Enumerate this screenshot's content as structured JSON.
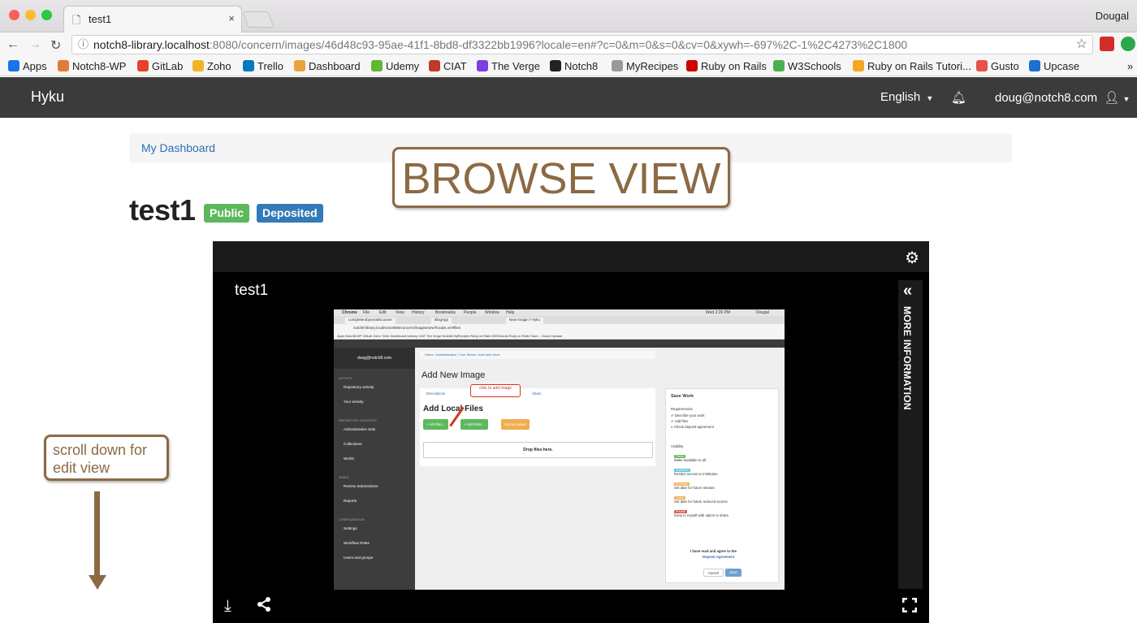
{
  "browser": {
    "tab_title": "test1",
    "tab_close": "×",
    "profile_name": "Dougal",
    "url_host": "notch8-library.localhost",
    "url_rest": ":8080/concern/images/46d48c93-95ae-41f1-8bd8-df3322bb1996?locale=en#?c=0&m=0&s=0&cv=0&xywh=-697%2C-1%2C4273%2C1800",
    "bookmarks": [
      {
        "label": "Apps",
        "color": "#1a73e8"
      },
      {
        "label": "Notch8-WP",
        "color": "#e07b39"
      },
      {
        "label": "GitLab",
        "color": "#e24329"
      },
      {
        "label": "Zoho",
        "color": "#f0b429"
      },
      {
        "label": "Trello",
        "color": "#0079bf"
      },
      {
        "label": "Dashboard",
        "color": "#e8a33d"
      },
      {
        "label": "Udemy",
        "color": "#5fb832"
      },
      {
        "label": "CIAT",
        "color": "#c0392b"
      },
      {
        "label": "The Verge",
        "color": "#7b3fe4"
      },
      {
        "label": "Notch8",
        "color": "#222222"
      },
      {
        "label": "MyRecipes",
        "color": "#999999"
      },
      {
        "label": "Ruby on Rails",
        "color": "#cc0000"
      },
      {
        "label": "W3Schools",
        "color": "#4caf50"
      },
      {
        "label": "Ruby on Rails Tutori...",
        "color": "#f5a623"
      },
      {
        "label": "Gusto",
        "color": "#e8504b"
      },
      {
        "label": "Upcase",
        "color": "#1f6fd1"
      }
    ],
    "bookmarks_more": "»"
  },
  "app_nav": {
    "brand": "Hyku",
    "language": "English",
    "user": "doug@notch8.com"
  },
  "breadcrumb": {
    "label": "My Dashboard"
  },
  "work": {
    "title": "test1",
    "badges": [
      {
        "label": "Public",
        "color": "#5cb85c"
      },
      {
        "label": "Deposited",
        "color": "#337ab7"
      }
    ]
  },
  "annotations": {
    "browse_view": "BROWSE VIEW",
    "scroll_hint": "scroll down for edit view",
    "color": "#8b6a44"
  },
  "viewer": {
    "title": "test1",
    "more_information": "MORE INFORMATION",
    "icons": [
      "gear-icon",
      "download-icon",
      "share-icon",
      "fullscreen-icon",
      "chevron-double-left-icon"
    ]
  },
  "embedded": {
    "menu": [
      "Chrome",
      "File",
      "Edit",
      "View",
      "History",
      "Bookmarks",
      "People",
      "Window",
      "Help"
    ],
    "clock": "Wed 2:26 PM",
    "user_short": "Dougal",
    "tabs": [
      "completerubyonrailscourse",
      "BlogApp",
      "New Image // Hyku"
    ],
    "url": "notch8-library.localhost:8080/concern/images/new?locale=en#files",
    "bookmarks_line": "Apps  Notch8-WP  GitLab  Zoho  Trello  Dashboard  Udemy  CIAT  The Verge  Notch8  MyRecipes  Ruby on Rails  W3Schools  Ruby on Rails Tutori...  Gusto  Upcase",
    "sidebar_user": "doug@notch8.com",
    "sidebar": [
      {
        "type": "hd",
        "text": "ACTIVITY"
      },
      {
        "type": "it",
        "text": "Repository activity"
      },
      {
        "type": "it",
        "text": "Your activity"
      },
      {
        "type": "hd",
        "text": "REPOSITORY CONTENTS"
      },
      {
        "type": "it",
        "text": "Administrative Sets"
      },
      {
        "type": "it",
        "text": "Collections"
      },
      {
        "type": "it",
        "text": "Works"
      },
      {
        "type": "hd",
        "text": "TASKS"
      },
      {
        "type": "it",
        "text": "Review Submissions"
      },
      {
        "type": "it",
        "text": "Reports"
      },
      {
        "type": "hd",
        "text": "CONFIGURATION"
      },
      {
        "type": "it",
        "text": "Settings"
      },
      {
        "type": "it",
        "text": "Workflow Roles"
      },
      {
        "type": "it",
        "text": "Users and groups"
      }
    ],
    "crumb": "Home  /  Administration  /  Your Works  /  Add New Work",
    "heading": "Add New Image",
    "tab_descriptions": "Descriptions",
    "tab_share": "Share",
    "callout": "click to add image",
    "files_heading": "Add Local Files",
    "btn_add_files": "+ Add files...",
    "btn_add_folder": "+ Add folder...",
    "btn_cancel_upload": "Cancel upload",
    "drop": "Drop files here.",
    "save_work": "Save Work",
    "requirements": "Requirements",
    "req1": "Describe your work",
    "req2": "Add files",
    "req3": "Check deposit agreement",
    "visibility": "Visibility",
    "vis": [
      {
        "label": "Public",
        "desc": "Make available to all.",
        "color": "#5cb85c"
      },
      {
        "label": "Institution",
        "desc": "Restrict access to Institution.",
        "color": "#5bc0de"
      },
      {
        "label": "Embargo",
        "desc": "Set date for future release.",
        "color": "#f0ad4e"
      },
      {
        "label": "Lease",
        "desc": "Set date for future reduced access.",
        "color": "#f0ad4e"
      },
      {
        "label": "Private",
        "desc": "Keep to myself with option to share.",
        "color": "#d9534f"
      }
    ],
    "agree": "I have read and agree to the",
    "agreement": "Deposit Agreement",
    "cancel": "Cancel",
    "save": "Save"
  }
}
